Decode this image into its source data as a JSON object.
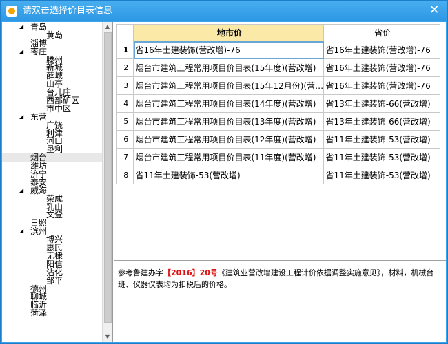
{
  "window": {
    "title": "请双击选择价目表信息",
    "close_glyph": "✕"
  },
  "tree": {
    "items": [
      {
        "label": "青岛",
        "level": 0,
        "expanded": true
      },
      {
        "label": "黄岛",
        "level": 1
      },
      {
        "label": "淄博",
        "level": 0
      },
      {
        "label": "枣庄",
        "level": 0,
        "expanded": true
      },
      {
        "label": "滕州",
        "level": 1
      },
      {
        "label": "新城",
        "level": 1
      },
      {
        "label": "薛城",
        "level": 1
      },
      {
        "label": "山亭",
        "level": 1
      },
      {
        "label": "台儿庄",
        "level": 1
      },
      {
        "label": "西部矿区",
        "level": 1
      },
      {
        "label": "市中区",
        "level": 1
      },
      {
        "label": "东营",
        "level": 0,
        "expanded": true
      },
      {
        "label": "广饶",
        "level": 1
      },
      {
        "label": "利津",
        "level": 1
      },
      {
        "label": "河口",
        "level": 1
      },
      {
        "label": "垦利",
        "level": 1
      },
      {
        "label": "烟台",
        "level": 0,
        "selected": true
      },
      {
        "label": "潍坊",
        "level": 0
      },
      {
        "label": "济宁",
        "level": 0
      },
      {
        "label": "泰安",
        "level": 0
      },
      {
        "label": "威海",
        "level": 0,
        "expanded": true
      },
      {
        "label": "荣成",
        "level": 1
      },
      {
        "label": "乳山",
        "level": 1
      },
      {
        "label": "文登",
        "level": 1
      },
      {
        "label": "日照",
        "level": 0
      },
      {
        "label": "滨州",
        "level": 0,
        "expanded": true
      },
      {
        "label": "博兴",
        "level": 1
      },
      {
        "label": "惠民",
        "level": 1
      },
      {
        "label": "无棣",
        "level": 1
      },
      {
        "label": "阳信",
        "level": 1
      },
      {
        "label": "沾化",
        "level": 1
      },
      {
        "label": "邹平",
        "level": 1
      },
      {
        "label": "德州",
        "level": 0
      },
      {
        "label": "聊城",
        "level": 0
      },
      {
        "label": "临沂",
        "level": 0
      },
      {
        "label": "菏泽",
        "level": 0
      }
    ]
  },
  "grid": {
    "headers": {
      "col1": "地市价",
      "col2": "省价"
    },
    "rows": [
      {
        "idx": "1",
        "col1": "省16年土建装饰(营改增)-76",
        "col2": "省16年土建装饰(营改增)-76"
      },
      {
        "idx": "2",
        "col1": "烟台市建筑工程常用项目价目表(15年度)(营改增)",
        "col2": "省16年土建装饰(营改增)-76"
      },
      {
        "idx": "3",
        "col1": "烟台市建筑工程常用项目价目表(15年12月份)(营…",
        "col2": "省16年土建装饰(营改增)-76"
      },
      {
        "idx": "4",
        "col1": "烟台市建筑工程常用项目价目表(14年度)(营改增)",
        "col2": "省13年土建装饰-66(营改增)"
      },
      {
        "idx": "5",
        "col1": "烟台市建筑工程常用项目价目表(13年度)(营改增)",
        "col2": "省13年土建装饰-66(营改增)"
      },
      {
        "idx": "6",
        "col1": "烟台市建筑工程常用项目价目表(12年度)(营改增)",
        "col2": "省11年土建装饰-53(营改增)"
      },
      {
        "idx": "7",
        "col1": "烟台市建筑工程常用项目价目表(11年度)(营改增)",
        "col2": "省11年土建装饰-53(营改增)"
      },
      {
        "idx": "8",
        "col1": "省11年土建装饰-53(营改增)",
        "col2": "省11年土建装饰-53(营改增)"
      }
    ]
  },
  "note": {
    "prefix": "参考鲁建办字",
    "highlight": "【2016】20号",
    "suffix": "《建筑业营改增建设工程计价依据调整实施意见》，材料，机械台班、仪器仪表均为扣税后的价格。"
  },
  "colors": {
    "titlebar": "#2d97e4",
    "header_selected": "#fbe9a8",
    "highlight_red": "#dd1111"
  }
}
